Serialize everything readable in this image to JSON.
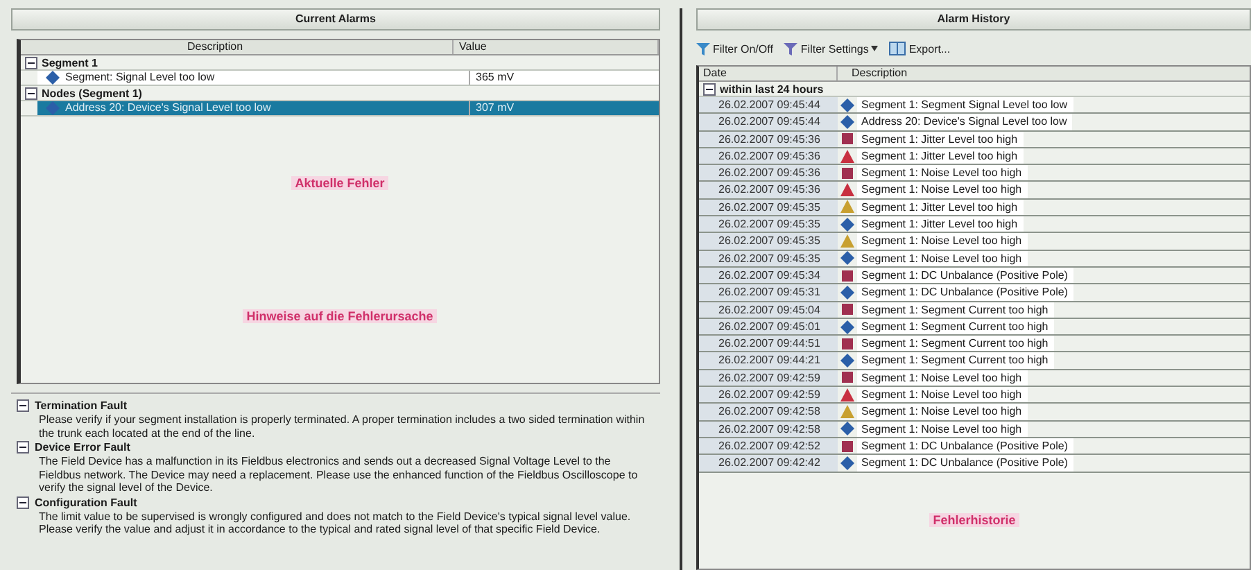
{
  "current_alarms": {
    "title": "Current Alarms",
    "columns": [
      "Description",
      "Value"
    ],
    "groups": [
      {
        "label": "Segment 1",
        "expanded": true,
        "rows": [
          {
            "description": "Segment: Signal Level too low",
            "value": "365 mV",
            "selected": false,
            "kind": "diamond",
            "color": "#2b5fa8"
          }
        ]
      },
      {
        "label": "Nodes (Segment 1)",
        "expanded": true,
        "rows": [
          {
            "description": "Address 20: Device's Signal Level too low",
            "value": "307 mV",
            "selected": true,
            "kind": "diamond",
            "color": "#2b5fa8"
          }
        ]
      }
    ],
    "annotation": "Aktuelle Fehler"
  },
  "hints": {
    "annotation": "Hinweise auf die Fehlerursache",
    "items": [
      {
        "title": "Termination Fault",
        "expanded": true,
        "text": "Please verify if your segment installation is properly terminated. A proper termination includes a two sided termination within the trunk each located at the end of the line."
      },
      {
        "title": "Device Error Fault",
        "expanded": true,
        "text": "The Field Device has a malfunction in its Fieldbus electronics and sends out a decreased Signal Voltage Level to the Fieldbus network. The Device may need a replacement. Please use the enhanced function of the Fieldbus Oscilloscope to verify the signal level of the Device."
      },
      {
        "title": "Configuration Fault",
        "expanded": true,
        "text": "The limit value to be supervised is wrongly configured and does not match to the Field Device's typical signal level value. Please verify the value and adjust it in accordance to the typical and rated signal level of that specific Field Device."
      }
    ]
  },
  "alarm_history": {
    "title": "Alarm History",
    "toolbar": [
      {
        "label": "Filter On/Off",
        "kind": "filter"
      },
      {
        "label": "Filter Settings",
        "kind": "filter-settings"
      },
      {
        "label": "Export...",
        "kind": "export"
      }
    ],
    "columns": [
      "Date",
      "Description"
    ],
    "group": {
      "label": "within last 24 hours",
      "expanded": true
    },
    "rows": [
      {
        "date": "26.02.2007 09:45:44",
        "kind": "diamond",
        "color": "#2b5fa8",
        "description": "Segment 1: Segment Signal Level too low"
      },
      {
        "date": "26.02.2007 09:45:44",
        "kind": "diamond",
        "color": "#2b5fa8",
        "description": "Address 20: Device's Signal Level too low"
      },
      {
        "date": "26.02.2007 09:45:36",
        "kind": "square",
        "color": "#a03050",
        "description": "Segment 1: Jitter Level too high"
      },
      {
        "date": "26.02.2007 09:45:36",
        "kind": "triangle",
        "color": "#c83040",
        "description": "Segment 1: Jitter Level too high"
      },
      {
        "date": "26.02.2007 09:45:36",
        "kind": "square",
        "color": "#a03050",
        "description": "Segment 1: Noise Level too high"
      },
      {
        "date": "26.02.2007 09:45:36",
        "kind": "triangle",
        "color": "#c83040",
        "description": "Segment 1: Noise Level too high"
      },
      {
        "date": "26.02.2007 09:45:35",
        "kind": "triangle",
        "color": "#c8a030",
        "description": "Segment 1: Jitter Level too high"
      },
      {
        "date": "26.02.2007 09:45:35",
        "kind": "diamond",
        "color": "#2b5fa8",
        "description": "Segment 1: Jitter Level too high"
      },
      {
        "date": "26.02.2007 09:45:35",
        "kind": "triangle",
        "color": "#c8a030",
        "description": "Segment 1: Noise Level too high"
      },
      {
        "date": "26.02.2007 09:45:35",
        "kind": "diamond",
        "color": "#2b5fa8",
        "description": "Segment 1: Noise Level too high"
      },
      {
        "date": "26.02.2007 09:45:34",
        "kind": "square",
        "color": "#a03050",
        "description": "Segment 1: DC Unbalance (Positive Pole)"
      },
      {
        "date": "26.02.2007 09:45:31",
        "kind": "diamond",
        "color": "#2b5fa8",
        "description": "Segment 1: DC Unbalance (Positive Pole)"
      },
      {
        "date": "26.02.2007 09:45:04",
        "kind": "square",
        "color": "#a03050",
        "description": "Segment 1: Segment Current too high"
      },
      {
        "date": "26.02.2007 09:45:01",
        "kind": "diamond",
        "color": "#2b5fa8",
        "description": "Segment 1: Segment Current too high"
      },
      {
        "date": "26.02.2007 09:44:51",
        "kind": "square",
        "color": "#a03050",
        "description": "Segment 1: Segment Current too high"
      },
      {
        "date": "26.02.2007 09:44:21",
        "kind": "diamond",
        "color": "#2b5fa8",
        "description": "Segment 1: Segment Current too high"
      },
      {
        "date": "26.02.2007 09:42:59",
        "kind": "square",
        "color": "#a03050",
        "description": "Segment 1: Noise Level too high"
      },
      {
        "date": "26.02.2007 09:42:59",
        "kind": "triangle",
        "color": "#c83040",
        "description": "Segment 1: Noise Level too high"
      },
      {
        "date": "26.02.2007 09:42:58",
        "kind": "triangle",
        "color": "#c8a030",
        "description": "Segment 1: Noise Level too high"
      },
      {
        "date": "26.02.2007 09:42:58",
        "kind": "diamond",
        "color": "#2b5fa8",
        "description": "Segment 1: Noise Level too high"
      },
      {
        "date": "26.02.2007 09:42:52",
        "kind": "square",
        "color": "#a03050",
        "description": "Segment 1: DC Unbalance (Positive Pole)"
      },
      {
        "date": "26.02.2007 09:42:42",
        "kind": "diamond",
        "color": "#2b5fa8",
        "description": "Segment 1: DC Unbalance (Positive Pole)"
      }
    ],
    "annotation": "Fehlerhistorie"
  }
}
